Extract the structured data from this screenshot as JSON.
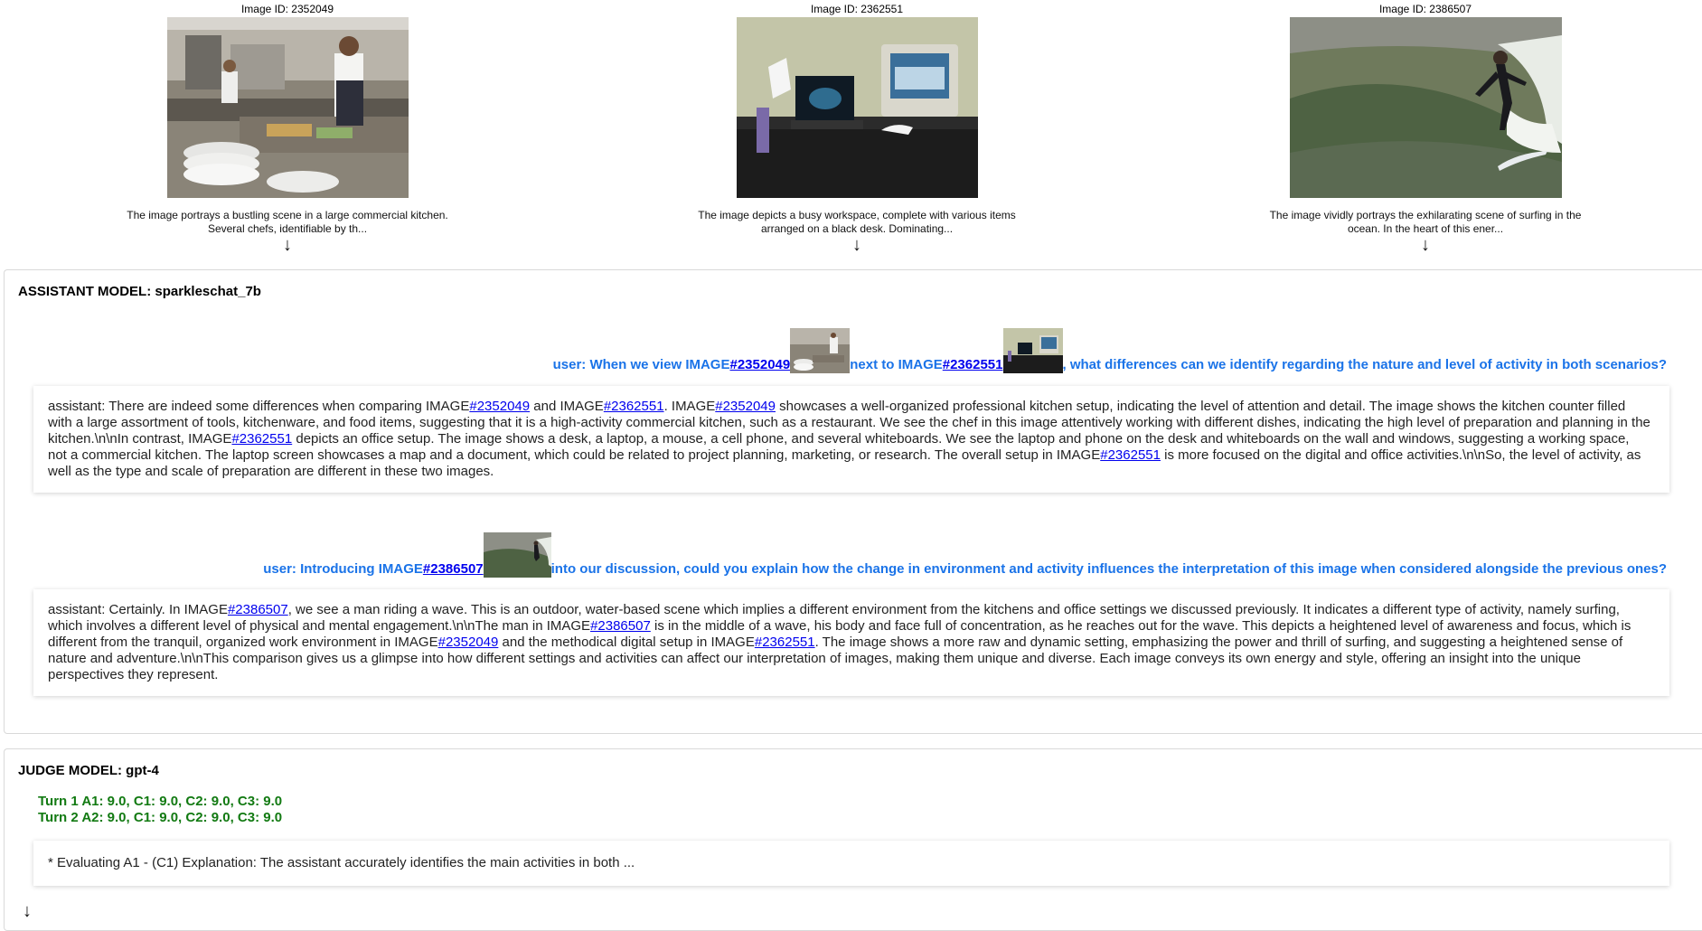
{
  "images": [
    {
      "id_label": "Image ID: 2352049",
      "caption": "The image portrays a bustling scene in a large commercial kitchen. Several chefs, identifiable by th..."
    },
    {
      "id_label": "Image ID: 2362551",
      "caption": "The image depicts a busy workspace, complete with various items arranged on a black desk. Dominating..."
    },
    {
      "id_label": "Image ID: 2386507",
      "caption": "The image vividly portrays the exhilarating scene of surfing in the ocean. In the heart of this ener..."
    }
  ],
  "arrow": "↓",
  "assistant_panel": {
    "title": "ASSISTANT MODEL: sparkleschat_7b",
    "turn1": {
      "user_p1": "user: When we view IMAGE",
      "link1": "#2352049",
      "user_p2": " next to IMAGE",
      "link2": "#2362551",
      "user_p3": ", what differences can we identify regarding the nature and level of activity in both scenarios?",
      "a_p1": "assistant: There are indeed some differences when comparing IMAGE",
      "a_l1": "#2352049",
      "a_p2": " and IMAGE",
      "a_l2": "#2362551",
      "a_p3": ". IMAGE",
      "a_l3": "#2352049",
      "a_p4": " showcases a well-organized professional kitchen setup, indicating the level of attention and detail. The image shows the kitchen counter filled with a large assortment of tools, kitchenware, and food items, suggesting that it is a high-activity commercial kitchen, such as a restaurant. We see the chef in this image attentively working with different dishes, indicating the high level of preparation and planning in the kitchen.\\n\\nIn contrast, IMAGE",
      "a_l4": "#2362551",
      "a_p5": " depicts an office setup. The image shows a desk, a laptop, a mouse, a cell phone, and several whiteboards. We see the laptop and phone on the desk and whiteboards on the wall and windows, suggesting a working space, not a commercial kitchen. The laptop screen showcases a map and a document, which could be related to project planning, marketing, or research. The overall setup in IMAGE",
      "a_l5": "#2362551",
      "a_p6": " is more focused on the digital and office activities.\\n\\nSo, the level of activity, as well as the type and scale of preparation are different in these two images."
    },
    "turn2": {
      "user_p1": "user: Introducing IMAGE",
      "link1": "#2386507",
      "user_p2": " into our discussion, could you explain how the change in environment and activity influences the interpretation of this image when considered alongside the previous ones?",
      "a_p1": "assistant: Certainly. In IMAGE",
      "a_l1": "#2386507",
      "a_p2": ", we see a man riding a wave. This is an outdoor, water-based scene which implies a different environment from the kitchens and office settings we discussed previously. It indicates a different type of activity, namely surfing, which involves a different level of physical and mental engagement.\\n\\nThe man in IMAGE",
      "a_l2": "#2386507",
      "a_p3": " is in the middle of a wave, his body and face full of concentration, as he reaches out for the wave. This depicts a heightened level of awareness and focus, which is different from the tranquil, organized work environment in IMAGE",
      "a_l3": "#2352049",
      "a_p4": " and the methodical digital setup in IMAGE",
      "a_l4": "#2362551",
      "a_p5": ". The image shows a more raw and dynamic setting, emphasizing the power and thrill of surfing, and suggesting a heightened sense of nature and adventure.\\n\\nThis comparison gives us a glimpse into how different settings and activities can affect our interpretation of images, making them unique and diverse. Each image conveys its own energy and style, offering an insight into the unique perspectives they represent."
    }
  },
  "judge_panel": {
    "title": "JUDGE MODEL: gpt-4",
    "score1": "Turn 1 A1: 9.0, C1: 9.0, C2: 9.0, C3: 9.0",
    "score2": "Turn 2 A2: 9.0, C1: 9.0, C2: 9.0, C3: 9.0",
    "eval_text": "* Evaluating A1 - (C1) Explanation: The assistant accurately identifies the main activities in both ..."
  }
}
